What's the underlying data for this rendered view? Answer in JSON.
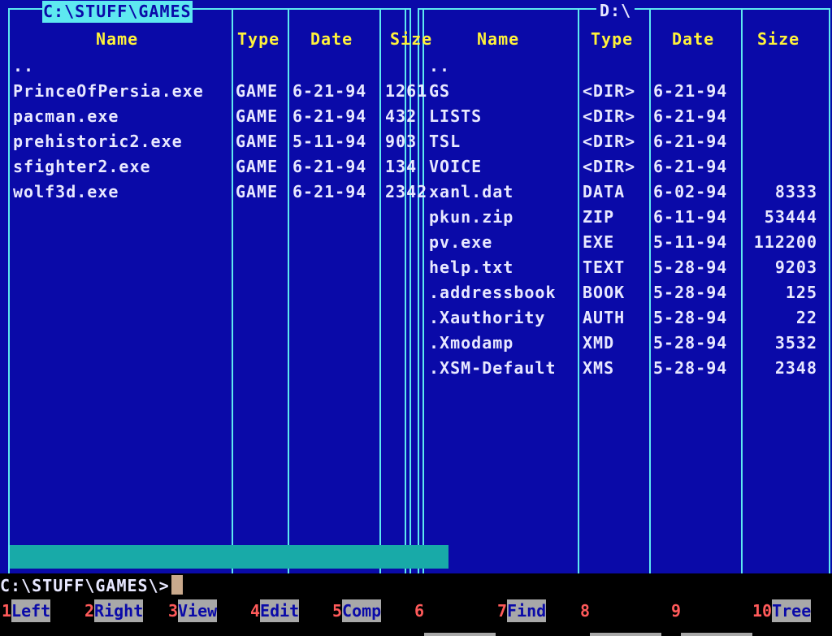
{
  "left_panel": {
    "path": "C:\\STUFF\\GAMES",
    "columns": [
      "Name",
      "Type",
      "Date",
      "Size"
    ],
    "rows": [
      {
        "name": "..",
        "type": "",
        "date": "",
        "size": ""
      },
      {
        "name": "PrinceOfPersia.exe",
        "type": "GAME",
        "date": "6-21-94",
        "size": "1261"
      },
      {
        "name": "pacman.exe",
        "type": "GAME",
        "date": "6-21-94",
        "size": "432"
      },
      {
        "name": "prehistoric2.exe",
        "type": "GAME",
        "date": "5-11-94",
        "size": "903"
      },
      {
        "name": "sfighter2.exe",
        "type": "GAME",
        "date": "6-21-94",
        "size": "134"
      },
      {
        "name": "wolf3d.exe",
        "type": "GAME",
        "date": "6-21-94",
        "size": "2342"
      }
    ]
  },
  "right_panel": {
    "path": "D:\\",
    "columns": [
      "Name",
      "Type",
      "Date",
      "Size"
    ],
    "rows": [
      {
        "name": "..",
        "type": "",
        "date": "",
        "size": ""
      },
      {
        "name": "GS",
        "type": "<DIR>",
        "date": "6-21-94",
        "size": ""
      },
      {
        "name": "LISTS",
        "type": "<DIR>",
        "date": "6-21-94",
        "size": ""
      },
      {
        "name": "TSL",
        "type": "<DIR>",
        "date": "6-21-94",
        "size": ""
      },
      {
        "name": "VOICE",
        "type": "<DIR>",
        "date": "6-21-94",
        "size": ""
      },
      {
        "name": "xanl.dat",
        "type": "DATA",
        "date": "6-02-94",
        "size": "8333"
      },
      {
        "name": "pkun.zip",
        "type": "ZIP",
        "date": "6-11-94",
        "size": "53444"
      },
      {
        "name": "pv.exe",
        "type": "EXE",
        "date": "5-11-94",
        "size": "112200"
      },
      {
        "name": "help.txt",
        "type": "TEXT",
        "date": "5-28-94",
        "size": "9203"
      },
      {
        "name": ".addressbook",
        "type": "BOOK",
        "date": "5-28-94",
        "size": "125"
      },
      {
        "name": ".Xauthority",
        "type": "AUTH",
        "date": "5-28-94",
        "size": "22"
      },
      {
        "name": ".Xmodamp",
        "type": "XMD",
        "date": "5-28-94",
        "size": "3532"
      },
      {
        "name": ".XSM-Default",
        "type": "XMS",
        "date": "5-28-94",
        "size": "2348"
      }
    ]
  },
  "command_line": {
    "prompt": "C:\\STUFF\\GAMES\\>"
  },
  "function_keys": [
    {
      "num": "1",
      "label": "Left"
    },
    {
      "num": "2",
      "label": "Right"
    },
    {
      "num": "3",
      "label": "View"
    },
    {
      "num": "4",
      "label": "Edit"
    },
    {
      "num": "5",
      "label": "Comp"
    },
    {
      "num": "6",
      "label": ""
    },
    {
      "num": "7",
      "label": "Find"
    },
    {
      "num": "8",
      "label": ""
    },
    {
      "num": "9",
      "label": ""
    },
    {
      "num": "10",
      "label": "Tree"
    }
  ],
  "colors": {
    "background": "#0a0aa8",
    "frame": "#5ee8f0",
    "header_text": "#fff23a",
    "text": "#e8e8ff",
    "fkey_number": "#ff5a5a",
    "fkey_label_bg": "#a8a8a8"
  }
}
